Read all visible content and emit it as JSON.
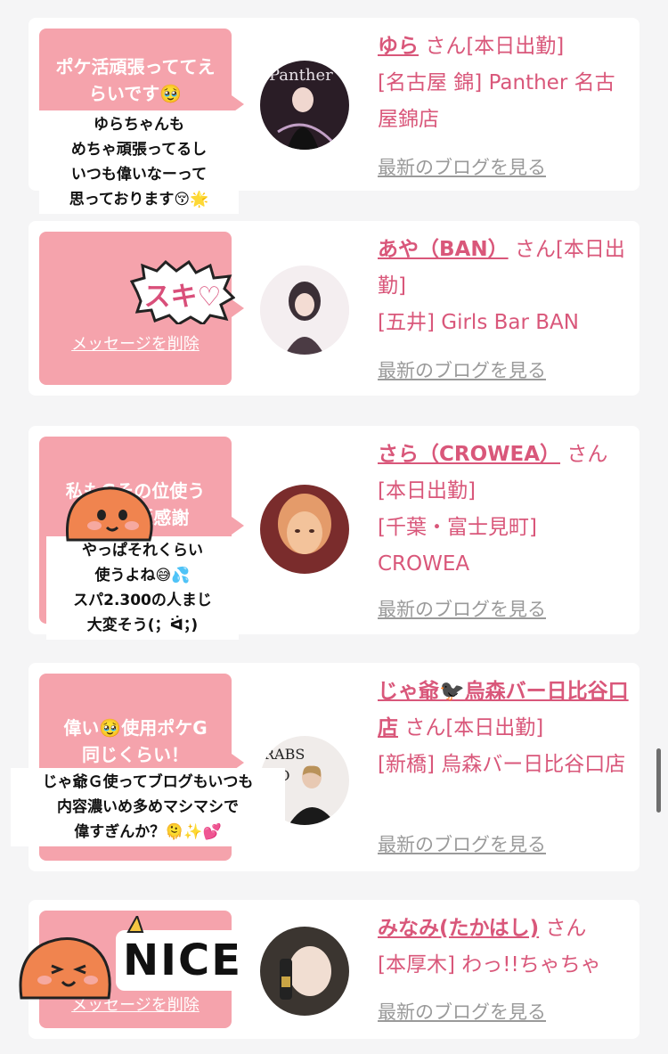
{
  "posts": [
    {
      "bubble_text": "ポケ活頑張っててえらいです🥹",
      "sticker_text": "ゆらちゃんも\nめちゃ頑張ってるし\nいつも偉いなーって\n思っております😚🌟",
      "name": "ゆら",
      "san": "さん",
      "status": "[本日出勤]",
      "location": "[名古屋 錦] Panther 名古屋錦店",
      "blog_link": "最新のブログを見る",
      "avatar_colors": [
        "#2a1d26",
        "#c2a0c6"
      ]
    },
    {
      "bubble_text": "",
      "delete_label": "メッセージを削除",
      "sticker_text": "スキ♡",
      "name": "あや（BAN）",
      "san": "さん",
      "status": "[本日出勤]",
      "location": "[五井] Girls Bar BAN",
      "blog_link": "最新のブログを見る",
      "avatar_colors": [
        "#f4eef0",
        "#4b3b44"
      ]
    },
    {
      "bubble_text": "私もGその位使う😅コメ返感謝",
      "sticker_text": "やっぱそれくらい\n使うよね😅💦\nスパ2.300の人まじ\n大変そう(；ᐛ；)",
      "name": "さら（CROWEA）",
      "san": "さん",
      "status": "[本日出勤]",
      "location": "[千葉・富士見町] CROWEA",
      "blog_link": "最新のブログを見る",
      "avatar_colors": [
        "#7a2c2c",
        "#f3c39b"
      ]
    },
    {
      "bubble_text": "偉い🥹使用ポケG同じくらい！",
      "sticker_text": "じゃ爺Ｇ使ってブログもいつも\n内容濃いめ多めマシマシで\n偉すぎんか？🫠✨💕",
      "name": "じゃ爺🐦‍⬛烏森バー日比谷口店",
      "san": "さん",
      "status": "[本日出勤]",
      "location": "[新橋] 烏森バー日比谷口店",
      "blog_link": "最新のブログを見る",
      "avatar_colors": [
        "#f0ecea",
        "#1a1a1a"
      ]
    },
    {
      "bubble_text": "",
      "delete_label": "メッセージを削除",
      "sticker_text": "NICE",
      "name": "みなみ(たかはし)",
      "san": "さん",
      "status": "",
      "location": "[本厚木] わっ!!ちゃちゃ",
      "blog_link": "最新のブログを見る",
      "avatar_colors": [
        "#3b3530",
        "#f1ded2"
      ]
    }
  ],
  "colors": {
    "bubble": "#f5a3ac",
    "accent": "#d9577a",
    "link_gray": "#9a9a9a"
  }
}
